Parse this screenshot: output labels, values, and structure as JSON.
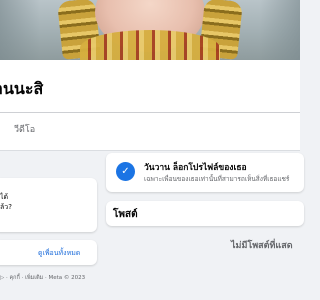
{
  "profile": {
    "name": "านนะสิ",
    "tabs": [
      {
        "label": "วีดีโอ"
      }
    ]
  },
  "intro": {
    "lines": [
      "ได้",
      "ล้ว?"
    ]
  },
  "profile_lock": {
    "title": "วันวาน ล็อกโปรไฟล์ของเธอ",
    "description": "เฉพาะเพื่อนของเธอเท่านั้นที่สามารถเห็นสิ่งที่เธอแชร์"
  },
  "posts": {
    "title": "โพสต์",
    "empty_message": "ไม่มีโพสต์ที่แสด"
  },
  "friends": {
    "see_all_label": "ดูเพื่อนทั้งหมด"
  },
  "footer": {
    "text": "▷ · คุกกี้ · เพิ่มเติม · Meta © 2023"
  },
  "colors": {
    "accent": "#1b74e4",
    "link": "#216fdb",
    "background": "#f0f2f5"
  },
  "icons": {
    "lock_card_icon": "shield-icon"
  }
}
